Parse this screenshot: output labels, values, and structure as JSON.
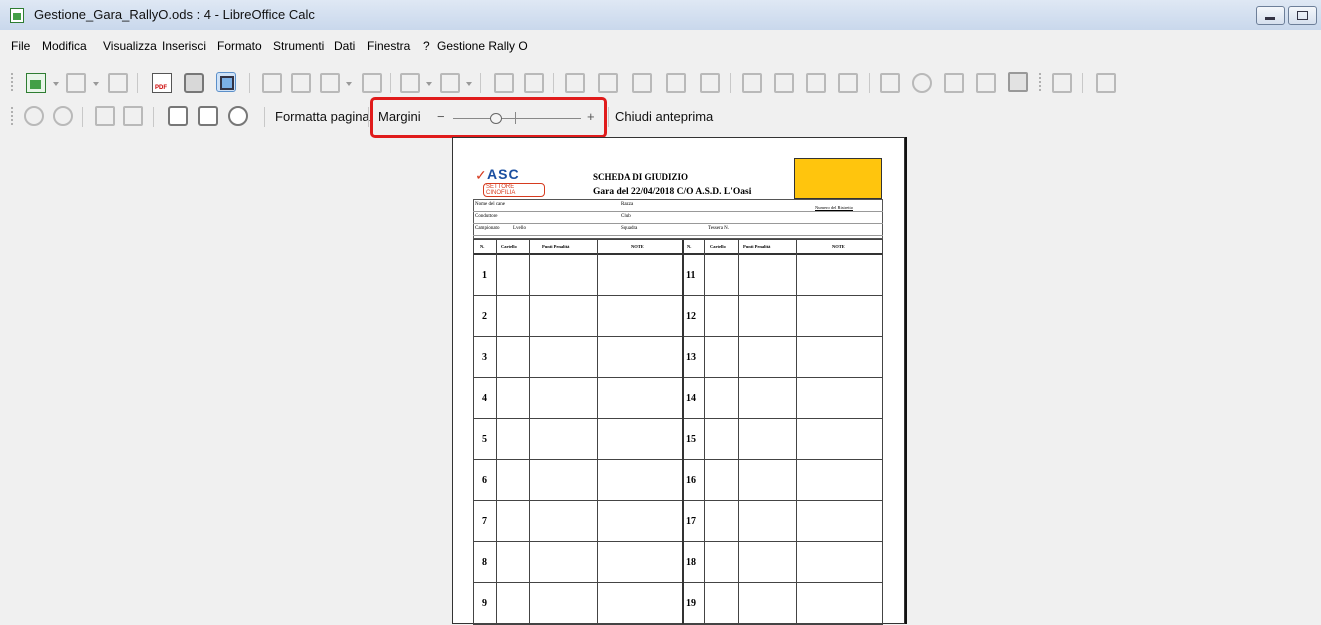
{
  "window": {
    "title": "Gestione_Gara_RallyO.ods : 4 - LibreOffice Calc"
  },
  "menu": [
    "File",
    "Modifica",
    "Visualizza",
    "Inserisci",
    "Formato",
    "Strumenti",
    "Dati",
    "Finestra",
    "?",
    "Gestione Rally O"
  ],
  "toolbar_icons": [
    "new-spreadsheet-icon",
    "templates-icon",
    "save-icon",
    "export-pdf-icon",
    "print-icon",
    "print-preview-icon",
    "cut-icon",
    "copy-icon",
    "paste-icon",
    "clone-formatting-icon",
    "undo-icon",
    "redo-icon",
    "spellcheck-icon",
    "find-replace-icon",
    "row-icon",
    "column-icon",
    "insert-table-icon",
    "freeze-icon",
    "merge-icon",
    "sort-ascending-icon",
    "sort-descending-icon",
    "sort-icon",
    "autofilter-icon",
    "image-icon",
    "chart-icon",
    "pivot-table-icon",
    "special-character-icon",
    "hyperlink-icon",
    "play-icon",
    "sidebar-icon"
  ],
  "preview_toolbar": {
    "format_page": "Formatta pagina",
    "margins": "Margini",
    "minus": "−",
    "plus": "+",
    "close_preview": "Chiudi anteprima",
    "zoom_percent": 40
  },
  "document": {
    "logo_text": "ASC",
    "logo_subtext": "SETTORE CINOFILIA",
    "title": "SCHEDA DI GIUDIZIO",
    "subtitle": "Gara del 22/04/2018 C/O A.S.D. L'Oasi",
    "fields": {
      "nome_cane": "Nome del cane",
      "razza": "Razza",
      "conduttore": "Conduttore",
      "club": "Club",
      "campionato": "Campionato",
      "liv": "Lvello",
      "squadra": "Squadra",
      "tessera": "Tessera N.",
      "numero_ristretto": "Numero del Ristretto"
    },
    "columns": [
      "N.",
      "Cartello",
      "Punti Penalità",
      "NOTE",
      "N.",
      "Cartello",
      "Punti Penalità",
      "NOTE"
    ],
    "rows_left": [
      "1",
      "2",
      "3",
      "4",
      "5",
      "6",
      "7",
      "8",
      "9"
    ],
    "rows_right": [
      "11",
      "12",
      "13",
      "14",
      "15",
      "16",
      "17",
      "18",
      "19"
    ]
  },
  "colors": {
    "highlight": "#e01b1b",
    "yellow_box": "#ffc50d",
    "logo_blue": "#1b4fa0"
  }
}
